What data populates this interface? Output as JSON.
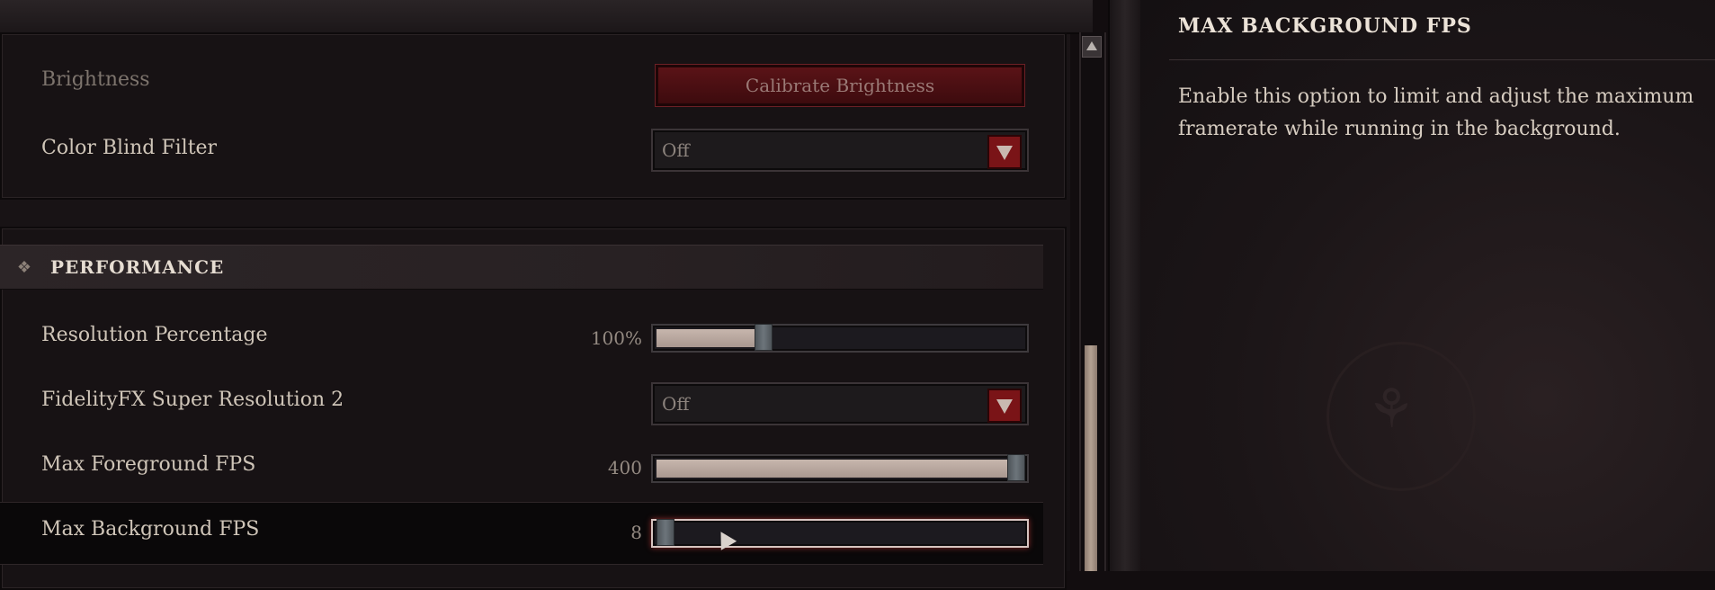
{
  "display": {
    "brightness": {
      "label": "Brightness",
      "button_label": "Calibrate Brightness"
    },
    "color_blind_filter": {
      "label": "Color Blind Filter",
      "value": "Off"
    }
  },
  "performance": {
    "section_title": "PERFORMANCE",
    "resolution_percentage": {
      "label": "Resolution Percentage",
      "value": "100%",
      "fill_fraction": 0.28
    },
    "fsr2": {
      "label": "FidelityFX Super Resolution 2",
      "value": "Off"
    },
    "max_foreground_fps": {
      "label": "Max Foreground FPS",
      "value": "400",
      "fill_fraction": 1.0
    },
    "max_background_fps": {
      "label": "Max Background FPS",
      "value": "8",
      "fill_fraction": 0.0
    }
  },
  "info_panel": {
    "title": "MAX BACKGROUND FPS",
    "description": "Enable this option to limit and adjust the maximum framerate while running in the background."
  },
  "icons": {
    "section_icon": "diamond-cluster-icon",
    "dropdown_arrow": "chevron-down-icon",
    "scroll_up": "arrow-up-icon",
    "cursor": "mouse-cursor-icon"
  },
  "colors": {
    "accent_red": "#7a1417",
    "slider_fill": "#c7b6ad"
  }
}
